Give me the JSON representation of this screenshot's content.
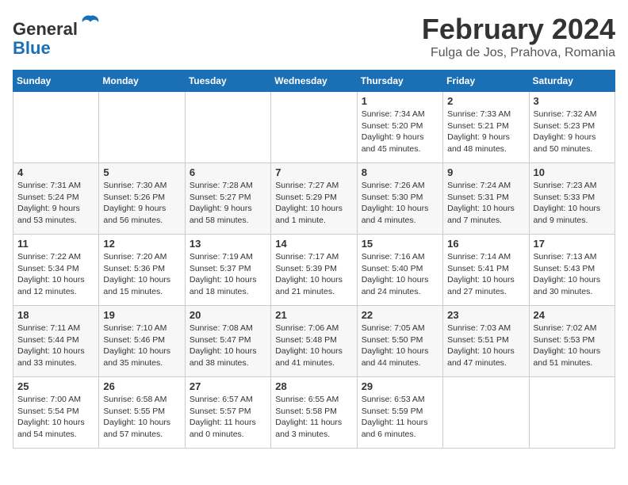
{
  "header": {
    "logo_general": "General",
    "logo_blue": "Blue",
    "month_title": "February 2024",
    "location": "Fulga de Jos, Prahova, Romania"
  },
  "weekdays": [
    "Sunday",
    "Monday",
    "Tuesday",
    "Wednesday",
    "Thursday",
    "Friday",
    "Saturday"
  ],
  "weeks": [
    [
      {
        "day": "",
        "info": ""
      },
      {
        "day": "",
        "info": ""
      },
      {
        "day": "",
        "info": ""
      },
      {
        "day": "",
        "info": ""
      },
      {
        "day": "1",
        "info": "Sunrise: 7:34 AM\nSunset: 5:20 PM\nDaylight: 9 hours\nand 45 minutes."
      },
      {
        "day": "2",
        "info": "Sunrise: 7:33 AM\nSunset: 5:21 PM\nDaylight: 9 hours\nand 48 minutes."
      },
      {
        "day": "3",
        "info": "Sunrise: 7:32 AM\nSunset: 5:23 PM\nDaylight: 9 hours\nand 50 minutes."
      }
    ],
    [
      {
        "day": "4",
        "info": "Sunrise: 7:31 AM\nSunset: 5:24 PM\nDaylight: 9 hours\nand 53 minutes."
      },
      {
        "day": "5",
        "info": "Sunrise: 7:30 AM\nSunset: 5:26 PM\nDaylight: 9 hours\nand 56 minutes."
      },
      {
        "day": "6",
        "info": "Sunrise: 7:28 AM\nSunset: 5:27 PM\nDaylight: 9 hours\nand 58 minutes."
      },
      {
        "day": "7",
        "info": "Sunrise: 7:27 AM\nSunset: 5:29 PM\nDaylight: 10 hours\nand 1 minute."
      },
      {
        "day": "8",
        "info": "Sunrise: 7:26 AM\nSunset: 5:30 PM\nDaylight: 10 hours\nand 4 minutes."
      },
      {
        "day": "9",
        "info": "Sunrise: 7:24 AM\nSunset: 5:31 PM\nDaylight: 10 hours\nand 7 minutes."
      },
      {
        "day": "10",
        "info": "Sunrise: 7:23 AM\nSunset: 5:33 PM\nDaylight: 10 hours\nand 9 minutes."
      }
    ],
    [
      {
        "day": "11",
        "info": "Sunrise: 7:22 AM\nSunset: 5:34 PM\nDaylight: 10 hours\nand 12 minutes."
      },
      {
        "day": "12",
        "info": "Sunrise: 7:20 AM\nSunset: 5:36 PM\nDaylight: 10 hours\nand 15 minutes."
      },
      {
        "day": "13",
        "info": "Sunrise: 7:19 AM\nSunset: 5:37 PM\nDaylight: 10 hours\nand 18 minutes."
      },
      {
        "day": "14",
        "info": "Sunrise: 7:17 AM\nSunset: 5:39 PM\nDaylight: 10 hours\nand 21 minutes."
      },
      {
        "day": "15",
        "info": "Sunrise: 7:16 AM\nSunset: 5:40 PM\nDaylight: 10 hours\nand 24 minutes."
      },
      {
        "day": "16",
        "info": "Sunrise: 7:14 AM\nSunset: 5:41 PM\nDaylight: 10 hours\nand 27 minutes."
      },
      {
        "day": "17",
        "info": "Sunrise: 7:13 AM\nSunset: 5:43 PM\nDaylight: 10 hours\nand 30 minutes."
      }
    ],
    [
      {
        "day": "18",
        "info": "Sunrise: 7:11 AM\nSunset: 5:44 PM\nDaylight: 10 hours\nand 33 minutes."
      },
      {
        "day": "19",
        "info": "Sunrise: 7:10 AM\nSunset: 5:46 PM\nDaylight: 10 hours\nand 35 minutes."
      },
      {
        "day": "20",
        "info": "Sunrise: 7:08 AM\nSunset: 5:47 PM\nDaylight: 10 hours\nand 38 minutes."
      },
      {
        "day": "21",
        "info": "Sunrise: 7:06 AM\nSunset: 5:48 PM\nDaylight: 10 hours\nand 41 minutes."
      },
      {
        "day": "22",
        "info": "Sunrise: 7:05 AM\nSunset: 5:50 PM\nDaylight: 10 hours\nand 44 minutes."
      },
      {
        "day": "23",
        "info": "Sunrise: 7:03 AM\nSunset: 5:51 PM\nDaylight: 10 hours\nand 47 minutes."
      },
      {
        "day": "24",
        "info": "Sunrise: 7:02 AM\nSunset: 5:53 PM\nDaylight: 10 hours\nand 51 minutes."
      }
    ],
    [
      {
        "day": "25",
        "info": "Sunrise: 7:00 AM\nSunset: 5:54 PM\nDaylight: 10 hours\nand 54 minutes."
      },
      {
        "day": "26",
        "info": "Sunrise: 6:58 AM\nSunset: 5:55 PM\nDaylight: 10 hours\nand 57 minutes."
      },
      {
        "day": "27",
        "info": "Sunrise: 6:57 AM\nSunset: 5:57 PM\nDaylight: 11 hours\nand 0 minutes."
      },
      {
        "day": "28",
        "info": "Sunrise: 6:55 AM\nSunset: 5:58 PM\nDaylight: 11 hours\nand 3 minutes."
      },
      {
        "day": "29",
        "info": "Sunrise: 6:53 AM\nSunset: 5:59 PM\nDaylight: 11 hours\nand 6 minutes."
      },
      {
        "day": "",
        "info": ""
      },
      {
        "day": "",
        "info": ""
      }
    ]
  ]
}
